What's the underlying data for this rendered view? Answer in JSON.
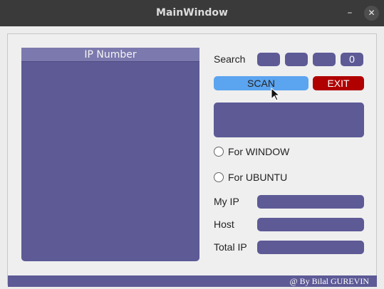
{
  "window": {
    "title": "MainWindow",
    "minimize_glyph": "–",
    "close_glyph": "✕"
  },
  "ip_list": {
    "header": "IP Number"
  },
  "search": {
    "label": "Search",
    "octets": [
      "",
      "",
      "",
      "0"
    ]
  },
  "buttons": {
    "scan": "SCAN",
    "exit": "EXIT"
  },
  "options": {
    "window": "For WINDOW",
    "ubuntu": "For UBUNTU"
  },
  "fields": {
    "my_ip": "My IP",
    "host": "Host",
    "total_ip": "Total IP"
  },
  "footer": {
    "credit": "@ By Bilal GUREVIN"
  },
  "colors": {
    "accent": "#5d5a96",
    "scan": "#5ba4f0",
    "exit": "#b00000",
    "titlebar": "#3a3a3a"
  },
  "icons": {
    "minimize": "minimize-icon",
    "close": "close-icon",
    "cursor": "mouse-pointer-icon"
  }
}
